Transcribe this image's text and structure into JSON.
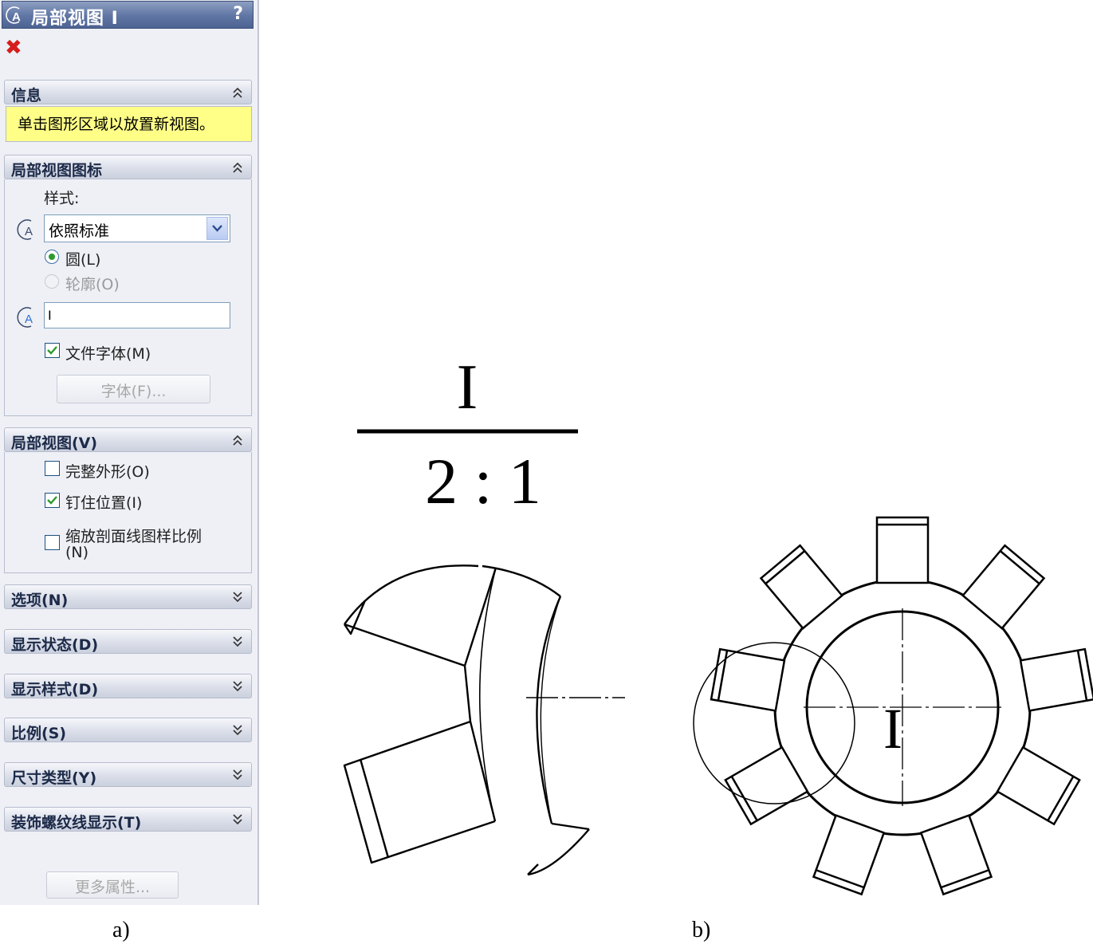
{
  "panel": {
    "title": "局部视图 I",
    "help": "?",
    "close": "✖",
    "info": {
      "header": "信息",
      "message": "单击图形区域以放置新视图。"
    },
    "icon_section": {
      "header": "局部视图图标",
      "style_label": "样式:",
      "style_value": "依照标准",
      "radio_circle": "圆(L)",
      "radio_outline": "轮廓(O)",
      "label_value": "I",
      "doc_font": "文件字体(M)",
      "doc_font_checked": true,
      "font_button": "字体(F)..."
    },
    "detail_section": {
      "header": "局部视图(V)",
      "full_outline": "完整外形(O)",
      "full_outline_checked": false,
      "pin_position": "钉住位置(I)",
      "pin_position_checked": true,
      "scale_hatch_line1": "缩放剖面线图样比例",
      "scale_hatch_line2": "(N)",
      "scale_hatch_checked": false
    },
    "collapsed_sections": [
      "选项(N)",
      "显示状态(D)",
      "显示样式(D)",
      "比例(S)",
      "尺寸类型(Y)",
      "装饰螺纹线显示(T)"
    ],
    "more_button": "更多属性..."
  },
  "drawing": {
    "detail_label": "I",
    "scale": "2 : 1",
    "circle_label": "I"
  },
  "captions": {
    "a": "a)",
    "b": "b)"
  },
  "colors": {
    "accent": "#5f75a3",
    "info_bg": "#ffff88",
    "close": "#d61d1d",
    "check": "#2c9a2c"
  }
}
